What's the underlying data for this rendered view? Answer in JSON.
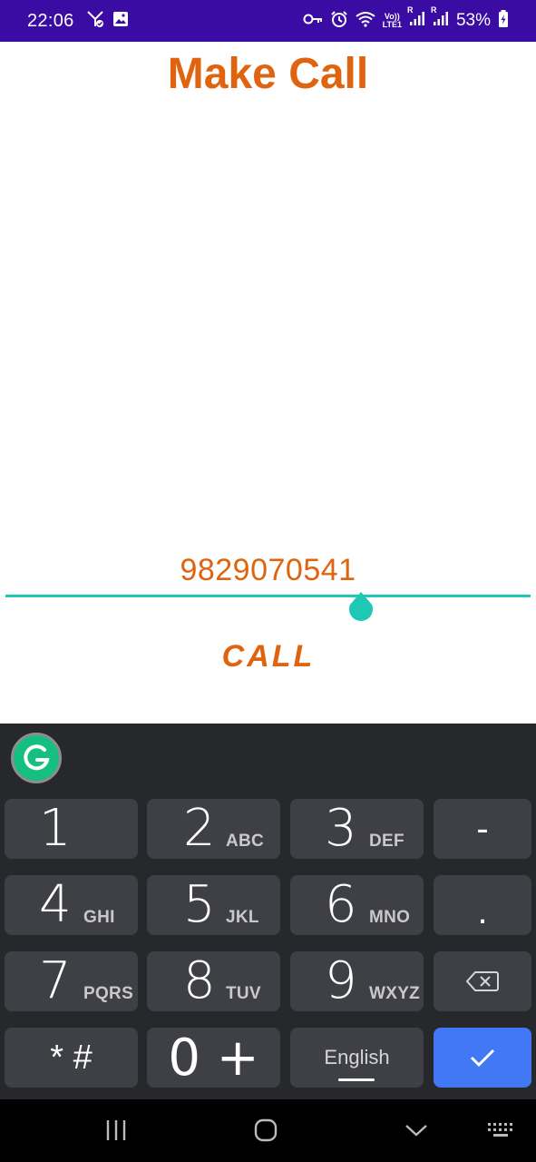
{
  "status_bar": {
    "time": "22:06",
    "battery": "53%",
    "volte": "Vo))",
    "lte": "LTE1",
    "sim1_roaming": "R",
    "sim2_roaming": "R",
    "icons": [
      "signal-share-icon",
      "image-icon",
      "key-icon",
      "alarm-icon",
      "wifi-icon",
      "cell-signal-icon",
      "cell-signal-icon",
      "battery-charging-icon"
    ]
  },
  "app": {
    "title": "Make Call",
    "phone_number": "9829070541",
    "call_label": "CALL",
    "accent_color": "#e0640f",
    "underline_color": "#1ec8b4"
  },
  "keyboard": {
    "toolbar_icon": "grammarly-icon",
    "keys": [
      {
        "digit": "1",
        "letters": ""
      },
      {
        "digit": "2",
        "letters": "ABC"
      },
      {
        "digit": "3",
        "letters": "DEF"
      },
      {
        "digit": "-",
        "letters": ""
      },
      {
        "digit": "4",
        "letters": "GHI"
      },
      {
        "digit": "5",
        "letters": "JKL"
      },
      {
        "digit": "6",
        "letters": "MNO"
      },
      {
        "digit": ".",
        "letters": ""
      },
      {
        "digit": "7",
        "letters": "PQRS"
      },
      {
        "digit": "8",
        "letters": "TUV"
      },
      {
        "digit": "9",
        "letters": "WXYZ"
      },
      {
        "digit": "",
        "letters": ""
      },
      {
        "digit": "* #",
        "letters": ""
      },
      {
        "digit": "0 +",
        "letters": ""
      },
      {
        "digit": "English",
        "letters": ""
      },
      {
        "digit": "",
        "letters": ""
      }
    ],
    "backspace_icon": "backspace-icon",
    "enter_icon": "checkmark-icon",
    "enter_color": "#4278f4"
  },
  "nav_bar": {
    "icons": [
      "recents-icon",
      "home-icon",
      "back-icon",
      "keyboard-icon"
    ]
  }
}
